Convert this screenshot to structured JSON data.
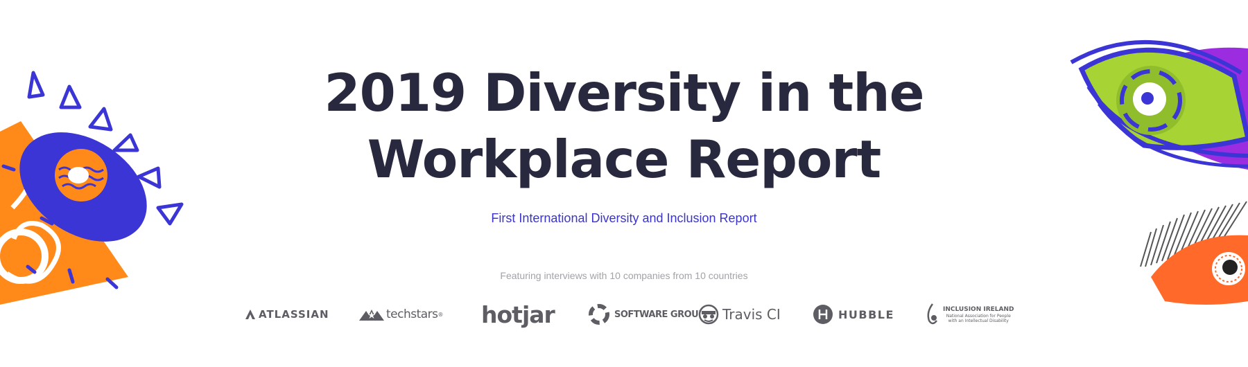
{
  "hero": {
    "title_line1": "2019 Diversity in the",
    "title_line2": "Workplace Report",
    "subtitle": "First International Diversity and Inclusion Report",
    "featuring": "Featuring interviews with 10 companies from 10 countries"
  },
  "colors": {
    "title": "#28283f",
    "subtitle": "#3a34c8",
    "muted": "#a2a2a8",
    "logo_gray": "#5d5d63",
    "illustration_blue": "#3b35d6",
    "illustration_orange": "#ff8a1a",
    "illustration_green": "#a8d334",
    "illustration_purple": "#9b2ce0"
  },
  "logos": [
    {
      "name": "ATLASSIAN",
      "icon": "atlassian-logo-icon"
    },
    {
      "name": "techstars",
      "mark": "®",
      "icon": "techstars-logo-icon"
    },
    {
      "name": "hotjar"
    },
    {
      "name_line1": "SOFTWARE",
      "name_line2": "GROUP",
      "icon": "software-group-logo-icon"
    },
    {
      "name": "Travis CI",
      "icon": "travis-ci-logo-icon"
    },
    {
      "name": "HUBBLE",
      "icon": "hubble-logo-icon"
    },
    {
      "name": "INCLUSION IRELAND",
      "tagline_line1": "National Association for People",
      "tagline_line2": "with an Intellectual Disability",
      "icon": "inclusion-ireland-logo-icon"
    }
  ]
}
